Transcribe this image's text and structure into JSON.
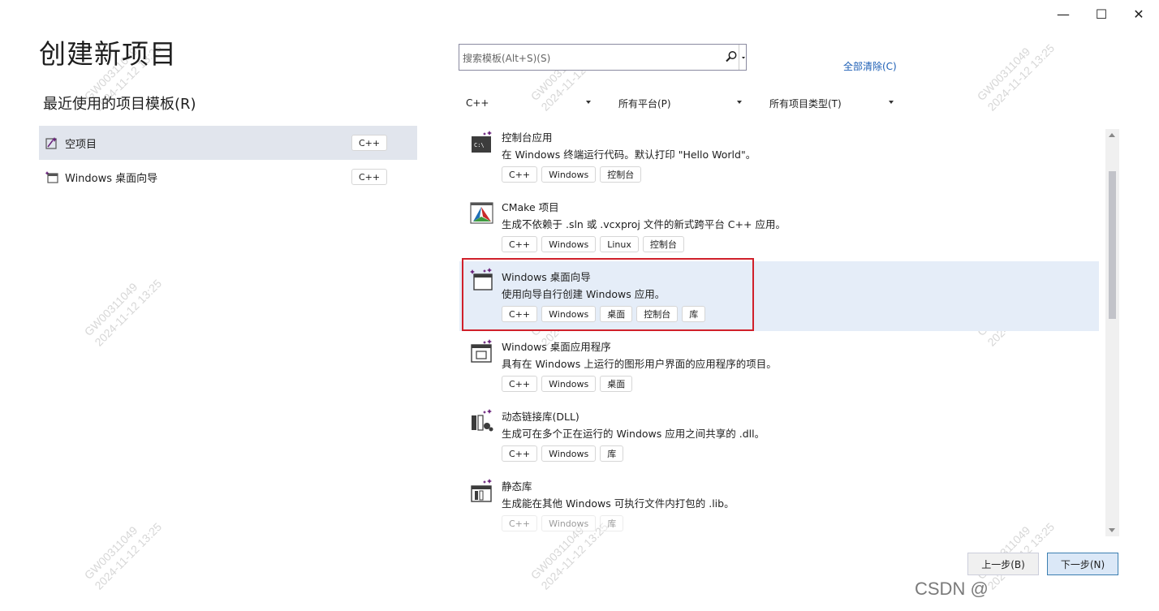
{
  "window": {
    "minimize_glyph": "—",
    "maximize_glyph": "☐",
    "close_glyph": "✕"
  },
  "page_title": "创建新项目",
  "recent": {
    "title": "最近使用的项目模板(R)",
    "items": [
      {
        "label": "空项目",
        "tag": "C++",
        "icon": "empty-project-icon"
      },
      {
        "label": "Windows 桌面向导",
        "tag": "C++",
        "icon": "wizard-icon"
      }
    ]
  },
  "search": {
    "placeholder": "搜索模板(Alt+S)(S)",
    "clear_all": "全部清除(C)"
  },
  "filters": {
    "language": "C++",
    "platform": "所有平台(P)",
    "project_type": "所有项目类型(T)"
  },
  "templates": [
    {
      "name": "控制台应用",
      "desc": "在 Windows 终端运行代码。默认打印 \"Hello World\"。",
      "tags": [
        "C++",
        "Windows",
        "控制台"
      ],
      "icon": "console-app-icon"
    },
    {
      "name": "CMake 项目",
      "desc": "生成不依赖于 .sln 或 .vcxproj 文件的新式跨平台 C++ 应用。",
      "tags": [
        "C++",
        "Windows",
        "Linux",
        "控制台"
      ],
      "icon": "cmake-icon"
    },
    {
      "name": "Windows 桌面向导",
      "desc": "使用向导自行创建 Windows 应用。",
      "tags": [
        "C++",
        "Windows",
        "桌面",
        "控制台",
        "库"
      ],
      "icon": "desktop-wizard-icon"
    },
    {
      "name": "Windows 桌面应用程序",
      "desc": "具有在 Windows 上运行的图形用户界面的应用程序的项目。",
      "tags": [
        "C++",
        "Windows",
        "桌面"
      ],
      "icon": "desktop-app-icon"
    },
    {
      "name": "动态链接库(DLL)",
      "desc": "生成可在多个正在运行的 Windows 应用之间共享的 .dll。",
      "tags": [
        "C++",
        "Windows",
        "库"
      ],
      "icon": "dll-icon"
    },
    {
      "name": "静态库",
      "desc": "生成能在其他 Windows 可执行文件内打包的 .lib。",
      "tags": [
        "C++",
        "Windows",
        "库"
      ],
      "icon": "static-lib-icon"
    }
  ],
  "buttons": {
    "back": "上一步(B)",
    "next": "下一步(N)"
  },
  "watermark": {
    "line1": "GW00311049",
    "line2": "2024-11-12 13:25"
  },
  "footer_brand": "CSDN @"
}
